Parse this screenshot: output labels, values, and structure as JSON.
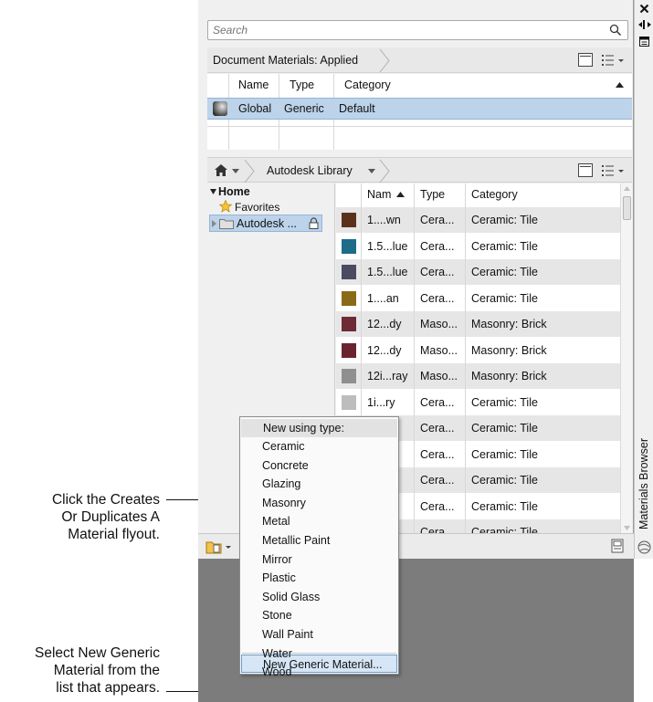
{
  "callouts": {
    "flyout_lines": [
      "Click the Creates",
      "Or Duplicates A",
      "Material flyout."
    ],
    "generic_lines": [
      "Select New Generic",
      "Material from the",
      "list that appears."
    ]
  },
  "search": {
    "placeholder": "Search"
  },
  "document_materials": {
    "breadcrumb": "Document Materials: Applied",
    "columns": [
      "Name",
      "Type",
      "Category"
    ],
    "rows": [
      {
        "name": "Global",
        "type": "Generic",
        "category": "Default"
      }
    ]
  },
  "library": {
    "breadcrumb": "Autodesk Library",
    "tree": {
      "home": "Home",
      "favorites": "Favorites",
      "autodesk": "Autodesk ..."
    },
    "columns": [
      "Nam",
      "Type",
      "Category"
    ],
    "rows": [
      {
        "swatch": "#5a321c",
        "name": "1....wn",
        "type": "Cera...",
        "category": "Ceramic: Tile"
      },
      {
        "swatch": "#1e6b8a",
        "name": "1.5...lue",
        "type": "Cera...",
        "category": "Ceramic: Tile"
      },
      {
        "swatch": "#4a4a60",
        "name": "1.5...lue",
        "type": "Cera...",
        "category": "Ceramic: Tile"
      },
      {
        "swatch": "#8a6a18",
        "name": "1....an",
        "type": "Cera...",
        "category": "Ceramic: Tile"
      },
      {
        "swatch": "#6e2b36",
        "name": "12...dy",
        "type": "Maso...",
        "category": "Masonry: Brick"
      },
      {
        "swatch": "#6a2430",
        "name": "12...dy",
        "type": "Maso...",
        "category": "Masonry: Brick"
      },
      {
        "swatch": "#8f8f8f",
        "name": "12i...ray",
        "type": "Maso...",
        "category": "Masonry: Brick"
      },
      {
        "swatch": "#bdbdbd",
        "name": "1i...ry",
        "type": "Cera...",
        "category": "Ceramic: Tile"
      },
      {
        "swatch": "#a0a0a0",
        "name": "",
        "type": "Cera...",
        "category": "Ceramic: Tile"
      },
      {
        "swatch": "#a0a0a0",
        "name": "",
        "type": "Cera...",
        "category": "Ceramic: Tile"
      },
      {
        "swatch": "#a0a0a0",
        "name": "",
        "type": "Cera...",
        "category": "Ceramic: Tile"
      },
      {
        "swatch": "#a0a0a0",
        "name": "",
        "type": "Cera...",
        "category": "Ceramic: Tile"
      },
      {
        "swatch": "#a0a0a0",
        "name": "",
        "type": "Cera",
        "category": "Ceramic: Tile"
      }
    ]
  },
  "flyout": {
    "header": "New using type:",
    "items": [
      "Ceramic",
      "Concrete",
      "Glazing",
      "Masonry",
      "Metal",
      "Metallic Paint",
      "Mirror",
      "Plastic",
      "Solid Glass",
      "Stone",
      "Wall Paint",
      "Water",
      "Wood"
    ],
    "new_generic": "New Generic Material..."
  },
  "palette_title": "Materials Browser"
}
